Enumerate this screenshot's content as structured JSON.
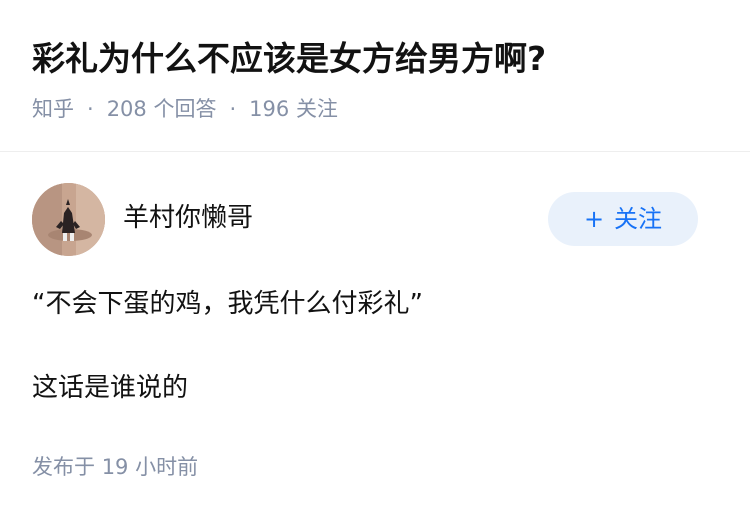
{
  "question": {
    "title": "彩礼为什么不应该是女方给男方啊?",
    "source": "知乎",
    "separator": "·",
    "answer_count": "208",
    "answer_count_label": "个回答",
    "follower_count": "196",
    "follower_count_label": "关注"
  },
  "author": {
    "name": "羊村你懒哥",
    "follow_icon": "+",
    "follow_label": "关注"
  },
  "answer": {
    "paragraphs": [
      "“不会下蛋的鸡，我凭什么付彩礼”",
      "这话是谁说的"
    ],
    "published_label": "发布于",
    "published_time": "19 小时前"
  },
  "colors": {
    "title": "#121212",
    "meta": "#8590a6",
    "follow_bg": "#e9f1fb",
    "follow_text": "#1772f6",
    "divider": "#eeeeee"
  }
}
